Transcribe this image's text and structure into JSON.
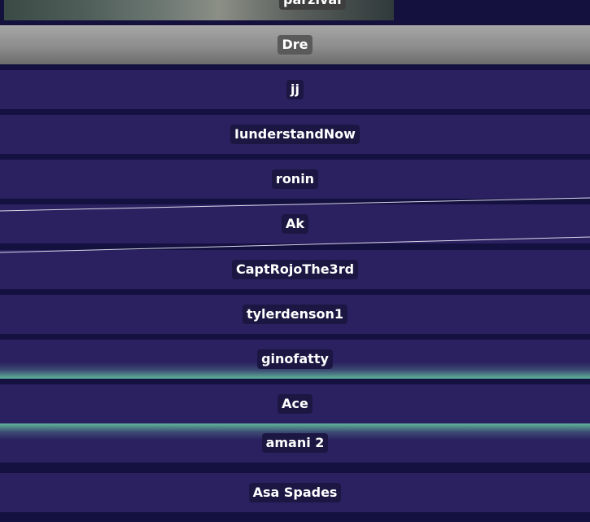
{
  "top_item": {
    "label": "parzival"
  },
  "players": [
    {
      "name": "Dre"
    },
    {
      "name": "jj"
    },
    {
      "name": "IunderstandNow"
    },
    {
      "name": "ronin"
    },
    {
      "name": "Ak"
    },
    {
      "name": "CaptRojoThe3rd"
    },
    {
      "name": "tylerdenson1"
    },
    {
      "name": "ginofatty"
    },
    {
      "name": "Ace"
    },
    {
      "name": "amani 2"
    },
    {
      "name": "Asa Spades"
    }
  ],
  "colors": {
    "background": "#141040",
    "row": "#2b2160",
    "selected_row": "#8d8d8d",
    "accent_glow": "#5fb59a",
    "name_tag": "#1b1642"
  }
}
